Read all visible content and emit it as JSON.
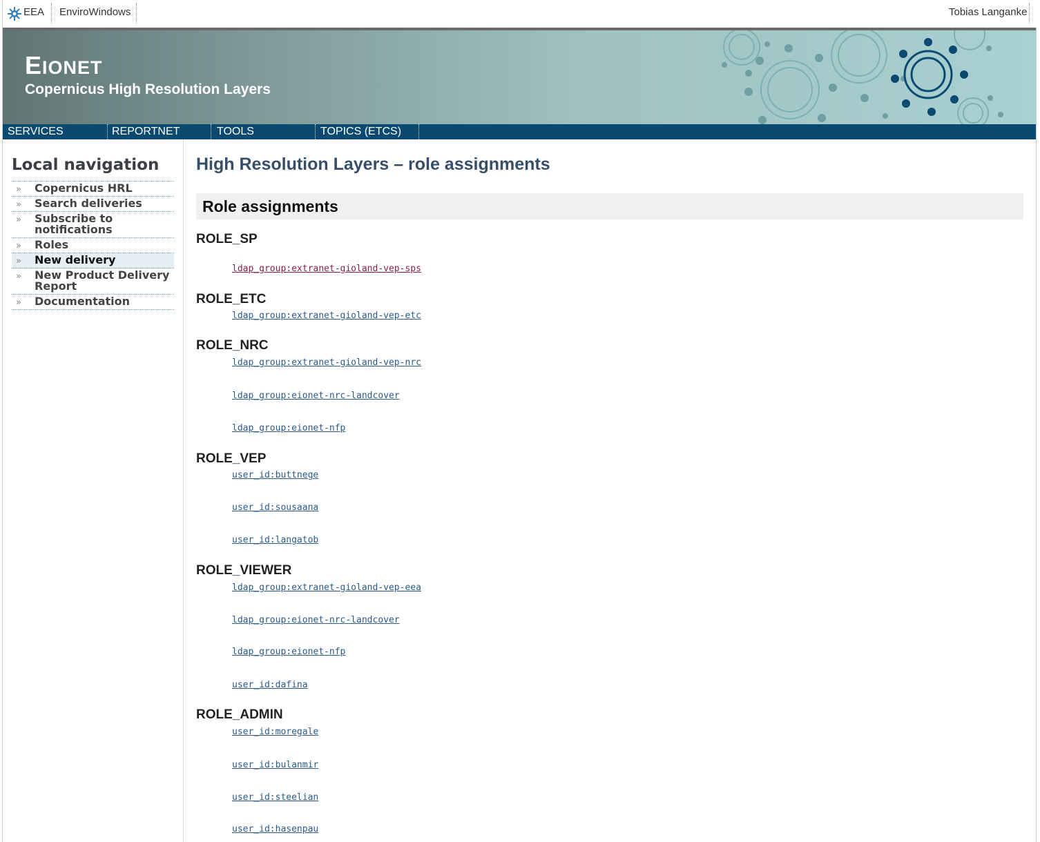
{
  "topbar": {
    "eea": "EEA",
    "envirowindows": "EnviroWindows",
    "user": "Tobias Langanke"
  },
  "header": {
    "brand_first": "E",
    "brand_rest": "IONET",
    "subtitle": "Copernicus High Resolution Layers"
  },
  "nav": {
    "services": "SERVICES",
    "reportnet": "REPORTNET",
    "tools": "TOOLS",
    "topics": "TOPICS (ETCS)"
  },
  "sidebar": {
    "title": "Local navigation",
    "arrow": "»",
    "items": [
      {
        "label": "Copernicus HRL"
      },
      {
        "label": "Search deliveries"
      },
      {
        "label": "Subscribe to notifications"
      },
      {
        "label": "Roles"
      },
      {
        "label": "New delivery",
        "current": true
      },
      {
        "label": "New Product Delivery Report"
      },
      {
        "label": "Documentation"
      }
    ]
  },
  "main": {
    "title": "High Resolution Layers – role assignments",
    "section": "Role assignments",
    "roles": [
      {
        "name": "ROLE_SP",
        "members": [
          "ldap_group:extranet-gioland-vep-sps"
        ]
      },
      {
        "name": "ROLE_ETC",
        "members": [
          "ldap_group:extranet-gioland-vep-etc"
        ]
      },
      {
        "name": "ROLE_NRC",
        "members": [
          "ldap_group:extranet-gioland-vep-nrc",
          "ldap_group:eionet-nrc-landcover",
          "ldap_group:eionet-nfp"
        ]
      },
      {
        "name": "ROLE_VEP",
        "members": [
          "user_id:buttnege",
          "user_id:sousaana",
          "user_id:langatob"
        ]
      },
      {
        "name": "ROLE_VIEWER",
        "members": [
          "ldap_group:extranet-gioland-vep-eea",
          "ldap_group:eionet-nrc-landcover",
          "ldap_group:eionet-nfp",
          "user_id:dafina"
        ]
      },
      {
        "name": "ROLE_ADMIN",
        "members": [
          "user_id:moregale",
          "user_id:bulanmir",
          "user_id:steelian",
          "user_id:hasenpau"
        ]
      }
    ]
  }
}
